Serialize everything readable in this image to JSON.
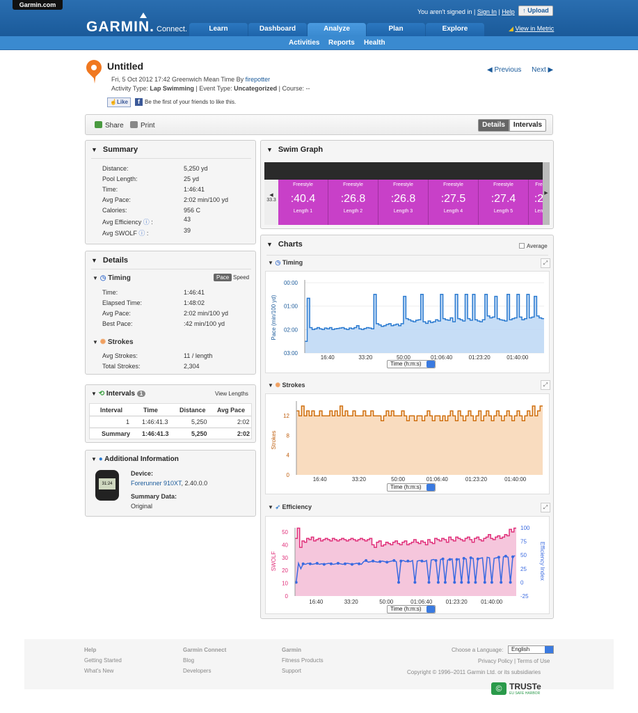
{
  "header": {
    "site_tab": "Garmin.com",
    "logo_main": "GARMIN.",
    "logo_sub": "Connect.",
    "not_signed": "You aren't signed in |",
    "sign_in": "Sign In",
    "help": "Help",
    "upload": "Upload",
    "view_metric": "View in Metric",
    "tabs": [
      "Learn",
      "Dashboard",
      "Analyze",
      "Plan",
      "Explore"
    ],
    "subnav": [
      "Activities",
      "Reports",
      "Health"
    ]
  },
  "activity": {
    "title": "Untitled",
    "datetime": "Fri, 5 Oct 2012 17:42 Greenwich Mean Time By",
    "user": "firepotter",
    "type_label": "Activity Type:",
    "type": "Lap Swimming",
    "event_label": "| Event Type:",
    "event": "Uncategorized",
    "course": "| Course: --",
    "like": "Like",
    "like_text": "Be the first of your friends to like this.",
    "previous": "Previous",
    "next": "Next"
  },
  "toolbar": {
    "share": "Share",
    "print": "Print",
    "details": "Details",
    "intervals": "Intervals"
  },
  "summary": {
    "title": "Summary",
    "rows": [
      {
        "label": "Distance:",
        "value": "5,250 yd"
      },
      {
        "label": "Pool Length:",
        "value": "25 yd"
      },
      {
        "label": "Time:",
        "value": "1:46:41"
      },
      {
        "label": "Avg Pace:",
        "value": "2:02 min/100 yd"
      },
      {
        "label": "Calories:",
        "value": "956 C"
      },
      {
        "label": "Avg Efficiency",
        "value": "43"
      },
      {
        "label": "Avg SWOLF",
        "value": "39"
      }
    ]
  },
  "details": {
    "title": "Details",
    "timing": "Timing",
    "pace": "Pace",
    "speed": "Speed",
    "timing_rows": [
      {
        "label": "Time:",
        "value": "1:46:41"
      },
      {
        "label": "Elapsed Time:",
        "value": "1:48:02"
      },
      {
        "label": "Avg Pace:",
        "value": "2:02 min/100 yd"
      },
      {
        "label": "Best Pace:",
        "value": ":42 min/100 yd"
      }
    ],
    "strokes": "Strokes",
    "stroke_rows": [
      {
        "label": "Avg Strokes:",
        "value": "11 / length"
      },
      {
        "label": "Total Strokes:",
        "value": "2,304"
      }
    ]
  },
  "intervals": {
    "title": "Intervals",
    "count": "1",
    "view_lengths": "View Lengths",
    "headers": [
      "Interval",
      "Time",
      "Distance",
      "Avg Pace"
    ],
    "rows": [
      [
        "1",
        "1:46:41.3",
        "5,250",
        "2:02"
      ]
    ],
    "summary": [
      "Summary",
      "1:46:41.3",
      "5,250",
      "2:02"
    ]
  },
  "additional": {
    "title": "Additional Information",
    "watch_time": "31:24",
    "device_label": "Device:",
    "device": "Forerunner 910XT",
    "version": ", 2.40.0.0",
    "summary_label": "Summary Data:",
    "summary_value": "Original"
  },
  "swim_graph": {
    "title": "Swim Graph",
    "left_val": "33.3",
    "lengths": [
      {
        "stroke": "Freestyle",
        "time": ":40.4",
        "label": "Length 1"
      },
      {
        "stroke": "Freestyle",
        "time": ":26.8",
        "label": "Length 2"
      },
      {
        "stroke": "Freestyle",
        "time": ":26.8",
        "label": "Length 3"
      },
      {
        "stroke": "Freestyle",
        "time": ":27.5",
        "label": "Length 4"
      },
      {
        "stroke": "Freestyle",
        "time": ":27.4",
        "label": "Length 5"
      },
      {
        "stroke": "Fre",
        "time": ":2",
        "label": "Len"
      }
    ]
  },
  "charts": {
    "title": "Charts",
    "average": "Average",
    "time_select": "Time (h:m:s)",
    "timing_title": "Timing",
    "strokes_title": "Strokes",
    "efficiency_title": "Efficiency"
  },
  "chart_data": [
    {
      "type": "area",
      "ylabel": "Pace (min/100 yd)",
      "y_ticks": [
        "00:00",
        "01:00",
        "02:00",
        "03:00"
      ],
      "x_ticks": [
        "16:40",
        "33:20",
        "50:00",
        "01:06:40",
        "01:23:20",
        "01:40:00"
      ],
      "y_reversed": true,
      "ylim": [
        0,
        180
      ],
      "series": [
        {
          "values": [
            150,
            40,
            115,
            120,
            118,
            115,
            118,
            120,
            116,
            118,
            115,
            120,
            118,
            117,
            116,
            115,
            118,
            120,
            116,
            118,
            115,
            110,
            118,
            120,
            117,
            115,
            116,
            118,
            30,
            105,
            108,
            112,
            110,
            107,
            105,
            110,
            108,
            106,
            110,
            105,
            35,
            92,
            95,
            98,
            100,
            96,
            95,
            30,
            100,
            104,
            98,
            102,
            100,
            95,
            98,
            30,
            92,
            95,
            96,
            90,
            100,
            30,
            92,
            95,
            98,
            30,
            92,
            96,
            30,
            95,
            98,
            100,
            95,
            30,
            85,
            90,
            88,
            35,
            92,
            95,
            96,
            98,
            30,
            95,
            92,
            90,
            30,
            88,
            95,
            92,
            30,
            90,
            88,
            35,
            85,
            90,
            92
          ]
        }
      ]
    },
    {
      "type": "area",
      "ylabel": "Strokes",
      "y_ticks": [
        "0",
        "4",
        "8",
        "12"
      ],
      "x_ticks": [
        "16:40",
        "33:20",
        "50:00",
        "01:06:40",
        "01:23:20",
        "01:40:00"
      ],
      "ylim": [
        0,
        15
      ],
      "series": [
        {
          "values": [
            13,
            12,
            14,
            12,
            13,
            12,
            13,
            12,
            12,
            13,
            12,
            12,
            12,
            13,
            12,
            13,
            12,
            14,
            12,
            13,
            12,
            12,
            13,
            12,
            12,
            12,
            13,
            12,
            12,
            13,
            12,
            12,
            12,
            11,
            12,
            13,
            12,
            13,
            12,
            12,
            12,
            13,
            12,
            11,
            12,
            12,
            11,
            12,
            12,
            11,
            12,
            13,
            12,
            11,
            12,
            12,
            11,
            12,
            11,
            12,
            13,
            12,
            11,
            13,
            12,
            11,
            12,
            13,
            12,
            11,
            12,
            13,
            11,
            12,
            13,
            12,
            11,
            12,
            13,
            12,
            11,
            12,
            13,
            12,
            11,
            12,
            13,
            12,
            11,
            12,
            13,
            12,
            14,
            12,
            13,
            14
          ]
        }
      ]
    },
    {
      "type": "line",
      "ylabel": "SWOLF",
      "y2label": "Efficiency Index",
      "y_ticks": [
        "0",
        "10",
        "20",
        "30",
        "40",
        "50"
      ],
      "y2_ticks": [
        "-25",
        "0",
        "25",
        "50",
        "75",
        "100"
      ],
      "x_ticks": [
        "16:40",
        "33:20",
        "50:00",
        "01:06:40",
        "01:23:20",
        "01:40:00"
      ],
      "series": [
        {
          "name": "SWOLF",
          "values": [
            45,
            53,
            38,
            43,
            42,
            45,
            44,
            46,
            43,
            44,
            45,
            43,
            44,
            45,
            44,
            43,
            45,
            44,
            43,
            44,
            45,
            44,
            43,
            44,
            45,
            44,
            43,
            44,
            45,
            44,
            43,
            44,
            45,
            40,
            38,
            42,
            43,
            39,
            40,
            42,
            41,
            40,
            42,
            43,
            41,
            40,
            42,
            43,
            40,
            41,
            42,
            44,
            42,
            41,
            43,
            42,
            40,
            44,
            42,
            41,
            45,
            44,
            43,
            45,
            44,
            42,
            46,
            44,
            43,
            46,
            45,
            44,
            43,
            45,
            46,
            44,
            42,
            45,
            46,
            44,
            43,
            45,
            46,
            48,
            45,
            44,
            46,
            47,
            45,
            46,
            48,
            47,
            52,
            50,
            53
          ]
        },
        {
          "name": "Efficiency Index",
          "values": [
            0,
            35,
            25,
            34,
            33,
            35,
            34,
            33,
            34,
            35,
            33,
            34,
            33,
            34,
            35,
            34,
            33,
            34,
            35,
            34,
            33,
            34,
            35,
            34,
            33,
            34,
            35,
            34,
            33,
            38,
            40,
            37,
            38,
            39,
            38,
            37,
            38,
            39,
            38,
            37,
            38,
            39,
            40,
            38,
            0,
            39,
            40,
            38,
            39,
            38,
            40,
            0,
            39,
            40,
            39,
            38,
            40,
            0,
            41,
            42,
            40,
            0,
            42,
            43,
            0,
            41,
            42,
            43,
            0,
            42,
            43,
            0,
            44,
            43,
            0,
            45,
            44,
            0,
            43,
            44,
            45,
            0,
            46,
            45,
            0,
            44,
            45,
            46,
            0,
            47,
            48,
            46,
            0,
            47,
            49
          ]
        }
      ]
    }
  ],
  "footer": {
    "col1": [
      "Help",
      "Getting Started",
      "What's New"
    ],
    "col2": [
      "Garmin Connect",
      "Blog",
      "Developers"
    ],
    "col3": [
      "Garmin",
      "Fitness Products",
      "Support"
    ],
    "lang_label": "Choose a Language:",
    "lang": "English",
    "privacy": "Privacy Policy | Terms of Use",
    "copyright": "Copyright © 1996–2011 Garmin Ltd. or its subsidiaries",
    "truste": "TRUSTe",
    "truste_sub": "EU SAFE HARBOR"
  },
  "colors": {
    "brand": "#1a5a9a",
    "pace": "#2a7ad0",
    "strokes": "#d07010",
    "swolf": "#e0307a",
    "eff": "#3a6ae0",
    "lane": "#c840c8"
  }
}
